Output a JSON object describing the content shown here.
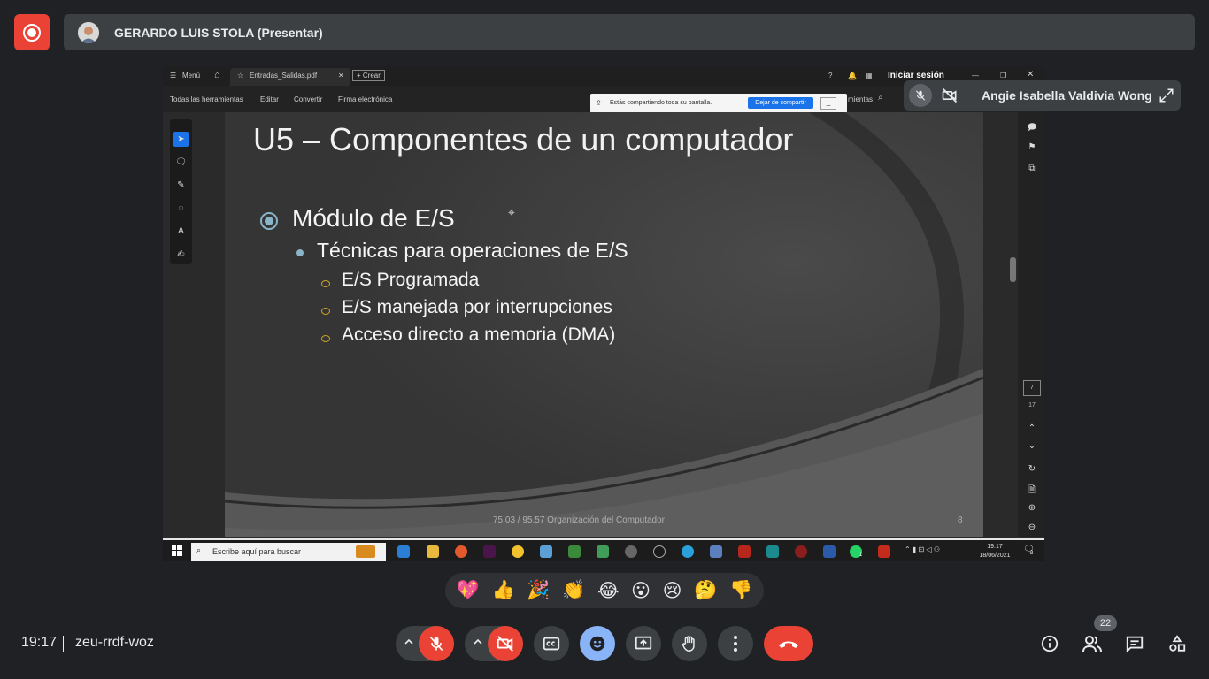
{
  "presenter": {
    "name": "GERARDO LUIS STOLA (Presentar)"
  },
  "acrobat": {
    "menu_label": "Menú",
    "tab_title": "Entradas_Salidas.pdf",
    "new_tab": "Crear",
    "signin": "Iniciar sesión",
    "tools": [
      "Todas las herramientas",
      "Editar",
      "Convertir",
      "Firma electrónica"
    ],
    "tools_right": "mientas",
    "share_notice": "Estás compartiendo toda su pantalla.",
    "share_stop": "Dejar de compartir",
    "page_current": "7",
    "page_total": "17"
  },
  "slide": {
    "title": "U5 – Componentes de un computador",
    "level1": "Módulo de E/S",
    "level2": "Técnicas para operaciones de E/S",
    "level3": [
      "E/S Programada",
      "E/S manejada por interrupciones",
      "Acceso directo a memoria (DMA)"
    ],
    "footer": "75.03 / 95.57 Organización del Computador",
    "number": "8"
  },
  "taskbar": {
    "search_placeholder": "Escribe aquí para buscar",
    "time": "19:17",
    "date": "18/06/2021",
    "notification_count": "2",
    "whatsapp_badge": "1"
  },
  "participant": {
    "name": "Angie Isabella Valdivia Wong"
  },
  "reactions": [
    "💖",
    "👍",
    "🎉",
    "👏",
    "😂",
    "😮",
    "😢",
    "🤔",
    "👎"
  ],
  "meeting": {
    "time": "19:17",
    "code": "zeu-rrdf-woz",
    "people_count": "22"
  },
  "colors": {
    "end_call": "#ea4335",
    "mic_off": "#ea4335",
    "reaction_active": "#8ab4f8",
    "background": "#202124"
  }
}
